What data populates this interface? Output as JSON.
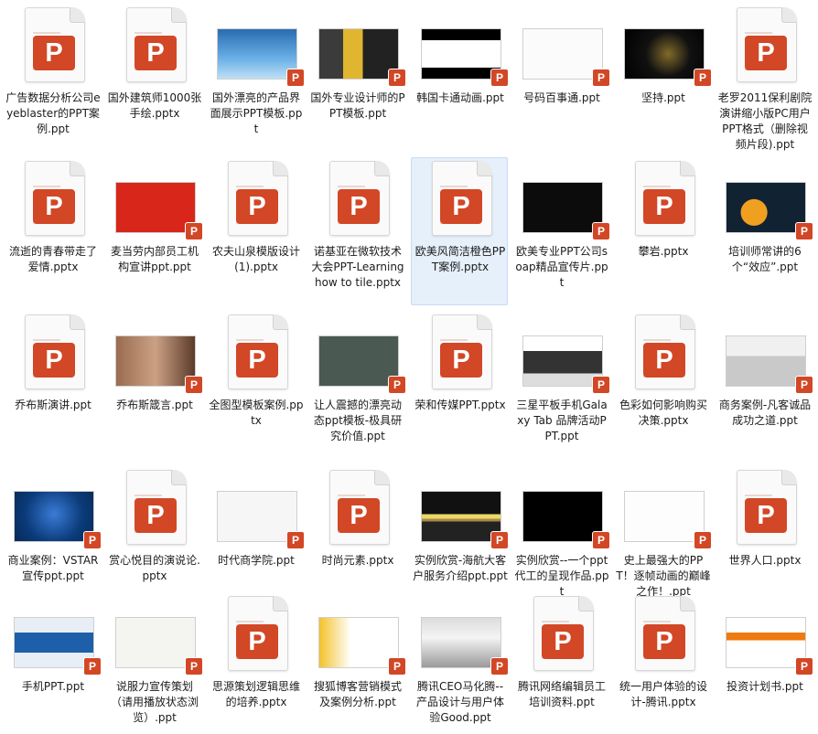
{
  "accent": "#d24726",
  "selection": "#e6f0fb",
  "badge_letter": "P",
  "files": [
    {
      "name": "广告数据分析公司eyeblaster的PPT案例.ppt",
      "thumb": "doc"
    },
    {
      "name": "国外建筑师1000张手绘.pptx",
      "thumb": "doc"
    },
    {
      "name": "国外漂亮的产品界面展示PPT模板.ppt",
      "thumb": "pic",
      "style": "blue-logo"
    },
    {
      "name": "国外专业设计师的PPT模板.ppt",
      "thumb": "pic",
      "style": "collage"
    },
    {
      "name": "韩国卡通动画.ppt",
      "thumb": "pic",
      "style": "bars-black"
    },
    {
      "name": "号码百事通.ppt",
      "thumb": "pic",
      "style": "white-map"
    },
    {
      "name": "坚持.ppt",
      "thumb": "pic",
      "style": "dark"
    },
    {
      "name": "老罗2011保利剧院演讲缩小版PC用户PPT格式（删除视频片段).ppt",
      "thumb": "doc"
    },
    {
      "name": "流逝的青春带走了爱情.pptx",
      "thumb": "doc"
    },
    {
      "name": "麦当劳内部员工机构宣讲ppt.ppt",
      "thumb": "pic",
      "style": "mcd"
    },
    {
      "name": "农夫山泉模版设计(1).pptx",
      "thumb": "doc"
    },
    {
      "name": "诺基亚在微软技术大会PPT-Learning how to tile.pptx",
      "thumb": "doc"
    },
    {
      "name": "欧美风简洁橙色PPT案例.pptx",
      "thumb": "doc",
      "selected": true
    },
    {
      "name": "欧美专业PPT公司soap精品宣传片.ppt",
      "thumb": "pic",
      "style": "soap"
    },
    {
      "name": "攀岩.pptx",
      "thumb": "doc"
    },
    {
      "name": "培训师常讲的6个“效应”.ppt",
      "thumb": "pic",
      "style": "six"
    },
    {
      "name": "乔布斯演讲.ppt",
      "thumb": "doc"
    },
    {
      "name": "乔布斯箴言.ppt",
      "thumb": "pic",
      "style": "jobs"
    },
    {
      "name": "全图型模板案例.pptx",
      "thumb": "doc"
    },
    {
      "name": "让人震撼的漂亮动态ppt模板-极具研究价值.ppt",
      "thumb": "pic",
      "style": "slate"
    },
    {
      "name": "荣和传媒PPT.pptx",
      "thumb": "doc"
    },
    {
      "name": "三星平板手机Galaxy Tab 品牌活动PPT.ppt",
      "thumb": "pic",
      "style": "samsung"
    },
    {
      "name": "色彩如何影响购买决策.pptx",
      "thumb": "doc"
    },
    {
      "name": "商务案例-凡客诚品成功之道.ppt",
      "thumb": "pic",
      "style": "vancl"
    },
    {
      "name": "商业案例：VSTAR宣传ppt.ppt",
      "thumb": "pic",
      "style": "vstar"
    },
    {
      "name": "赏心悦目的演说论.pptx",
      "thumb": "doc"
    },
    {
      "name": "时代商学院.ppt",
      "thumb": "pic",
      "style": "shidai"
    },
    {
      "name": "时尚元素.pptx",
      "thumb": "doc"
    },
    {
      "name": "实例欣赏-海航大客户服务介绍ppt.ppt",
      "thumb": "pic",
      "style": "hainan"
    },
    {
      "name": "实例欣赏--一个ppt代工的呈现作品.ppt",
      "thumb": "pic",
      "style": "black"
    },
    {
      "name": "史上最强大的PPT！逐帧动画的巅峰之作！.ppt",
      "thumb": "pic",
      "style": "page450"
    },
    {
      "name": "世界人口.pptx",
      "thumb": "doc"
    },
    {
      "name": "手机PPT.ppt",
      "thumb": "pic",
      "style": "phone"
    },
    {
      "name": "说服力宣传策划（请用播放状态浏览）.ppt",
      "thumb": "pic",
      "style": "persuade"
    },
    {
      "name": "思源策划逻辑思维的培养.pptx",
      "thumb": "doc"
    },
    {
      "name": "搜狐博客营销模式及案例分析.ppt",
      "thumb": "pic",
      "style": "sohu"
    },
    {
      "name": "腾讯CEO马化腾--产品设计与用户体验Good.ppt",
      "thumb": "pic",
      "style": "tencent"
    },
    {
      "name": "腾讯网络编辑员工培训资料.ppt",
      "thumb": "doc"
    },
    {
      "name": "统一用户体验的设计-腾讯.pptx",
      "thumb": "doc"
    },
    {
      "name": "投资计划书.ppt",
      "thumb": "pic",
      "style": "invest"
    }
  ]
}
